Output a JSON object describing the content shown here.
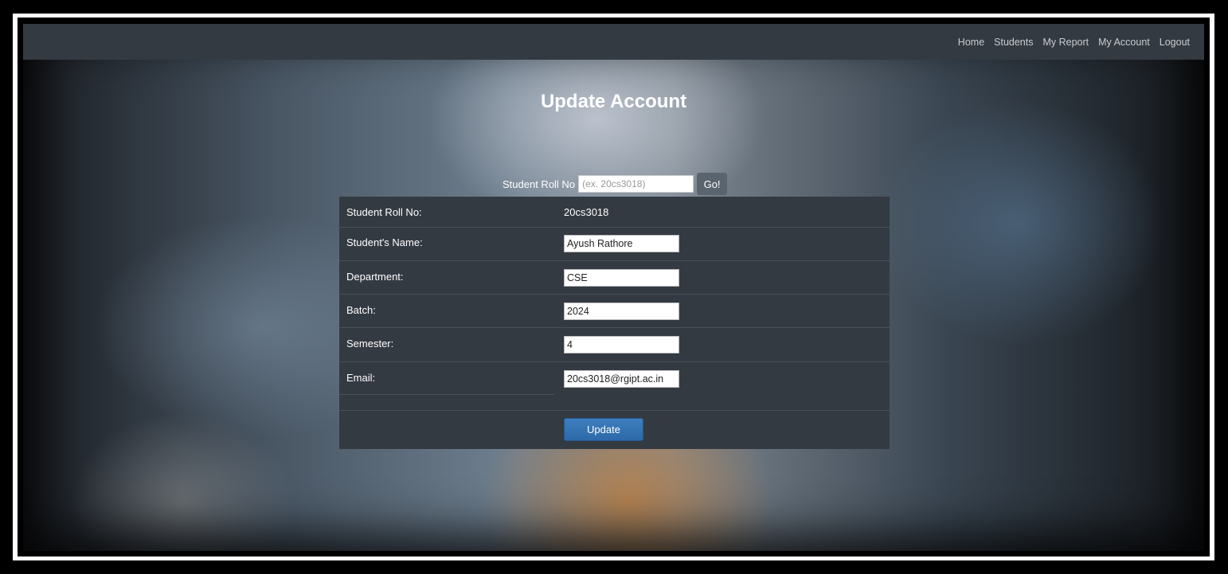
{
  "nav": {
    "items": [
      {
        "label": "Home"
      },
      {
        "label": "Students"
      },
      {
        "label": "My Report"
      },
      {
        "label": "My Account"
      },
      {
        "label": "Logout"
      }
    ]
  },
  "page": {
    "title": "Update Account"
  },
  "search": {
    "label": "Student Roll No",
    "placeholder": "(ex. 20cs3018)",
    "value": "",
    "go_label": "Go!"
  },
  "form": {
    "roll_no": {
      "label": "Student Roll No:",
      "value": "20cs3018"
    },
    "name": {
      "label": "Student's Name:",
      "value": "Ayush Rathore"
    },
    "department": {
      "label": "Department:",
      "value": "CSE"
    },
    "batch": {
      "label": "Batch:",
      "value": "2024"
    },
    "semester": {
      "label": "Semester:",
      "value": "4"
    },
    "email": {
      "label": "Email:",
      "value": "20cs3018@rgipt.ac.in"
    },
    "update_label": "Update"
  },
  "colors": {
    "navbar": "#343a42",
    "panel": "#343a42",
    "update_button": "#2c69a8",
    "go_button": "#5a646f"
  }
}
